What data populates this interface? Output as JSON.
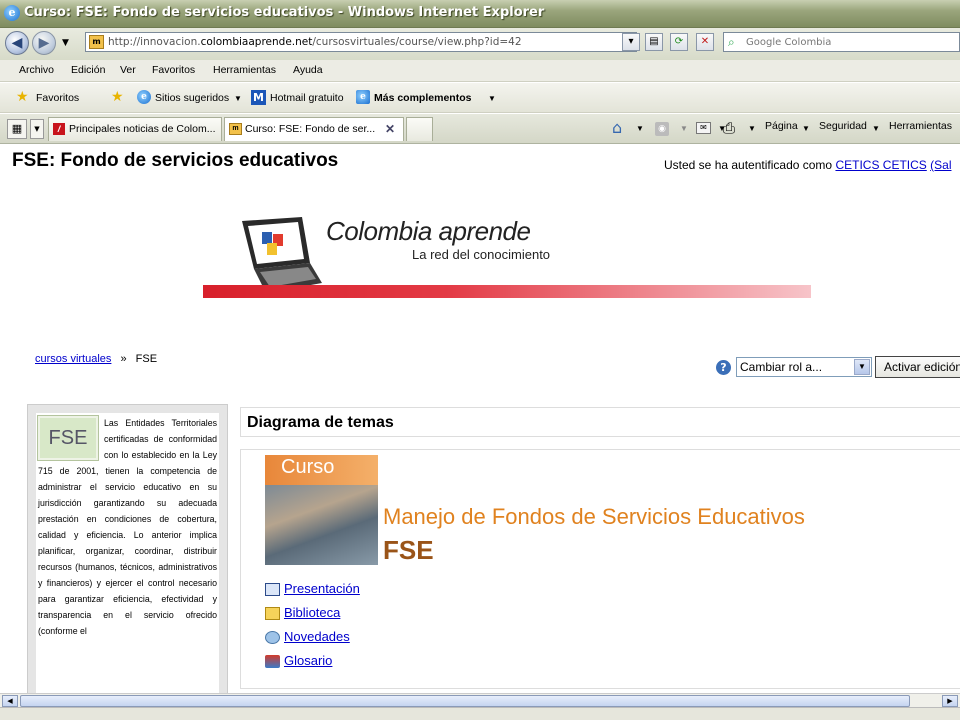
{
  "window": {
    "title": "Curso: FSE: Fondo de servicios educativos - Windows Internet Explorer"
  },
  "address": {
    "url_prefix": "http://innovacion.",
    "url_domain": "colombiaaprende.net",
    "url_path": "/cursosvirtuales/course/view.php?id=42"
  },
  "search": {
    "placeholder": "Google Colombia"
  },
  "menu": [
    "Archivo",
    "Edición",
    "Ver",
    "Favoritos",
    "Herramientas",
    "Ayuda"
  ],
  "favorites": {
    "label": "Favoritos",
    "items": [
      "Sitios sugeridos",
      "Hotmail gratuito",
      "Más complementos"
    ]
  },
  "tabs": [
    {
      "label": "Principales noticias de Colom..."
    },
    {
      "label": "Curso: FSE: Fondo de ser..."
    }
  ],
  "command_bar": {
    "page": "Página",
    "security": "Seguridad",
    "tools": "Herramientas"
  },
  "page": {
    "title": "FSE: Fondo de servicios educativos",
    "auth_text": "Usted se ha autentificado como",
    "auth_user": "CETICS CETICS",
    "auth_logout": "(Sal",
    "logo": {
      "name": "Colombia aprende",
      "tagline": "La red del conocimiento"
    },
    "breadcrumb": {
      "root": "cursos virtuales",
      "sep": "»",
      "current": "FSE"
    },
    "role_select": "Cambiar rol a...",
    "edit_button": "Activar edición",
    "side_logo": "FSE",
    "side_text": "Las Entidades Territoriales certificadas de conformidad con lo establecido en la Ley 715 de 2001, tienen la competencia de administrar el servicio educativo en su jurisdicción garantizando su adecuada prestación en condiciones de cobertura, calidad y eficiencia. Lo anterior implica planificar, organizar, coordinar, distribuir recursos (humanos, técnicos, administrativos y financieros) y ejercer el control necesario para garantizar eficiencia, efectividad y transparencia en el servicio ofrecido (conforme el",
    "themes_header": "Diagrama de temas",
    "course": {
      "badge": "Curso",
      "title": "Manejo de Fondos de Servicios Educativos",
      "subtitle": "FSE",
      "links": [
        "Presentación",
        "Biblioteca",
        "Novedades",
        "Glosario"
      ]
    }
  }
}
